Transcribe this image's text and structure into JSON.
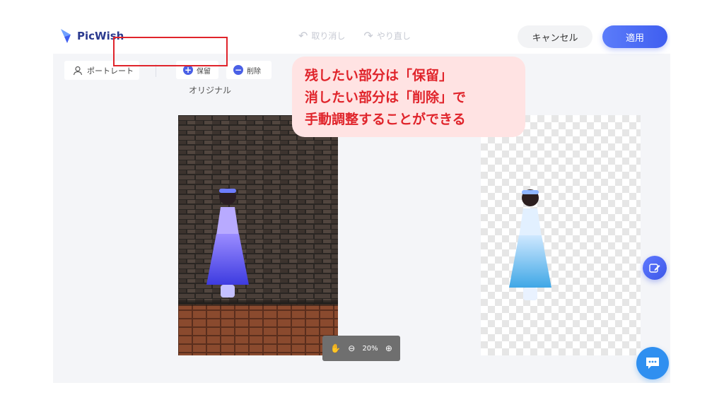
{
  "header": {
    "brand": "PicWish",
    "undo_label": "取り消し",
    "redo_label": "やり直し",
    "cancel_label": "キャンセル",
    "apply_label": "適用",
    "brand_color": "#3f5ef0"
  },
  "toolbar": {
    "portrait_label": "ポートレート",
    "keep_label": "保留",
    "delete_label": "削除"
  },
  "canvas": {
    "original_label": "オリジナル",
    "zoom_level": "20%"
  },
  "callout": {
    "line1": "残したい部分は「保留」",
    "line2": "消したい部分は「削除」で",
    "line3": "手動調整することができる",
    "color": "#e0242b"
  },
  "icons": [
    "person-icon",
    "plus-icon",
    "minus-icon",
    "undo-icon",
    "redo-icon",
    "hand-icon",
    "zoom-out-icon",
    "zoom-in-icon",
    "edit-icon",
    "chat-icon"
  ]
}
